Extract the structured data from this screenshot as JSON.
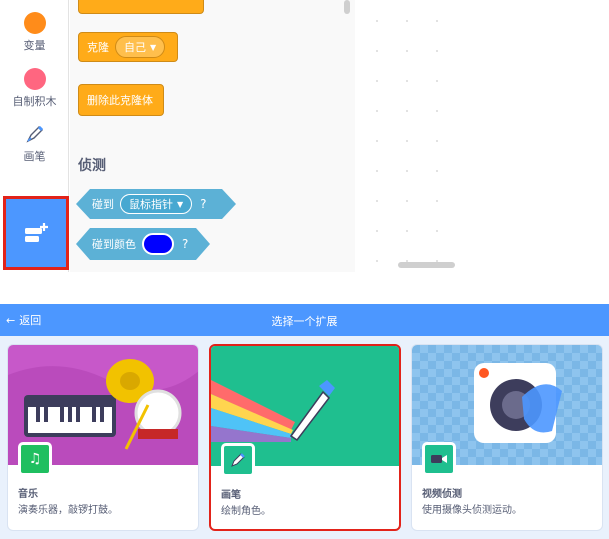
{
  "categories": [
    {
      "label": "变量",
      "color": "#ff8c1a"
    },
    {
      "label": "自制积木",
      "color": "#ff6680"
    },
    {
      "label": "画笔",
      "icon": "pen-icon"
    }
  ],
  "blocks": {
    "clone": {
      "label": "克隆",
      "option": "自己"
    },
    "delete_clone": {
      "label": "删除此克隆体"
    },
    "sensing_title": "侦测",
    "touching": {
      "label": "碰到",
      "option": "鼠标指针",
      "q": "?"
    },
    "touching_color": {
      "label": "碰到颜色",
      "q": "?",
      "color": "#0000ff"
    }
  },
  "library": {
    "back_label": "返回",
    "title": "选择一个扩展",
    "cards": [
      {
        "name": "音乐",
        "desc": "演奏乐器，敲锣打鼓。",
        "icon": "music-icon",
        "bg": "#c758c9"
      },
      {
        "name": "画笔",
        "desc": "绘制角色。",
        "icon": "pen-icon",
        "bg": "#1fbf8f"
      },
      {
        "name": "视频侦测",
        "desc": "使用摄像头侦测运动。",
        "icon": "video-icon",
        "bg": "#7bb7e6"
      }
    ]
  }
}
